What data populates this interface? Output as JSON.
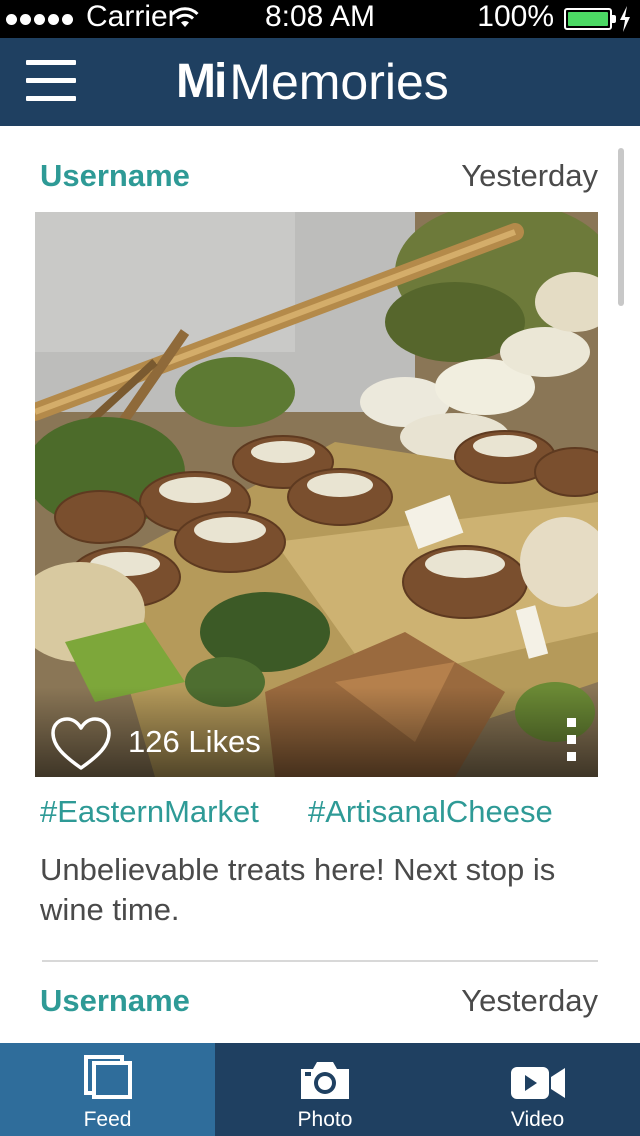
{
  "status_bar": {
    "carrier": "Carrier",
    "time": "8:08 AM",
    "battery_percent": "100%",
    "battery_level": 1.0,
    "battery_color": "#4cd964"
  },
  "nav": {
    "brand_mi": "Mi",
    "brand_rest": "Memories",
    "menu_icon": "hamburger-icon",
    "background": "#1f4061"
  },
  "accent_color": "#2e9a96",
  "posts": [
    {
      "username": "Username",
      "timestamp": "Yesterday",
      "likes": "126 Likes",
      "like_icon": "heart-outline-icon",
      "more_icon": "vertical-dots-icon",
      "tags": [
        "#EasternMarket",
        "#ArtisanalCheese"
      ],
      "caption": "Unbelievable treats here! Next stop is wine time."
    },
    {
      "username": "Username",
      "timestamp": "Yesterday"
    }
  ],
  "tabs": [
    {
      "label": "Feed",
      "icon": "feed-icon",
      "active": true
    },
    {
      "label": "Photo",
      "icon": "camera-icon",
      "active": false
    },
    {
      "label": "Video",
      "icon": "video-camera-icon",
      "active": false
    }
  ]
}
